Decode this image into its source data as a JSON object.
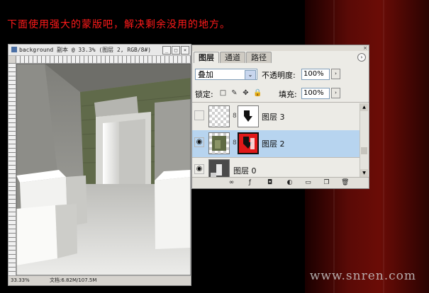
{
  "headline": "下面使用强大的蒙版吧，解决剩余没用的地方。",
  "watermark": "www.snren.com",
  "document": {
    "title": "background 副本 @ 33.3% (图层 2, RGB/8#)",
    "window_buttons": [
      "_",
      "□",
      "×"
    ],
    "zoom": "33.33%",
    "doc_size": "文档:6.82M/107.5M"
  },
  "layers_panel": {
    "tabs": [
      "图层",
      "通道",
      "路径"
    ],
    "active_tab": "图层",
    "menu_button": "›",
    "close_button": "×",
    "blend_mode": "叠加",
    "blend_arrow": "⌄",
    "opacity_label": "不透明度:",
    "opacity_value": "100%",
    "lock_label": "锁定:",
    "lock_icons": [
      "□",
      "✎",
      "✥",
      "🔒"
    ],
    "fill_label": "填充:",
    "fill_value": "100%",
    "stepper_arrow": "›",
    "layers": [
      {
        "name": "图层 3",
        "visible": false,
        "selected": false,
        "visibility_glyph": ""
      },
      {
        "name": "图层 2",
        "visible": true,
        "selected": true,
        "visibility_glyph": "◉"
      },
      {
        "name": "图层 0",
        "visible": true,
        "selected": false,
        "visibility_glyph": "◉"
      }
    ],
    "chain_glyph": "8",
    "bottom_icons": [
      "link-layers-icon",
      "layer-style-icon",
      "add-mask-icon",
      "adjustment-layer-icon",
      "new-group-icon",
      "new-layer-icon",
      "trash-icon"
    ],
    "bottom_glyphs": [
      "∞",
      "ƒ",
      "◘",
      "◐",
      "▭",
      "❐",
      "🗑"
    ]
  },
  "colors": {
    "headline": "#ff1a1a",
    "selected_row": "#b7d4ef",
    "mask_red": "#e01818"
  }
}
